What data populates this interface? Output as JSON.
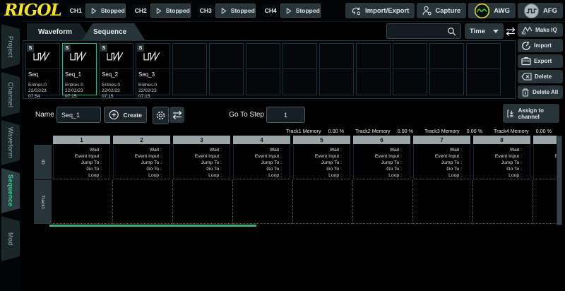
{
  "brand": "RIGOL",
  "colors": {
    "accent_green": "#3fd695",
    "brand_yellow": "#f6e41c",
    "header_gray": "#9aa3a6",
    "scrollbar_green": "#3fae7d"
  },
  "topbar": {
    "channels": [
      {
        "label": "CH1",
        "status": "Stopped"
      },
      {
        "label": "CH2",
        "status": "Stopped"
      },
      {
        "label": "CH3",
        "status": "Stopped"
      },
      {
        "label": "CH4",
        "status": "Stopped"
      }
    ],
    "import_export": "Import/Export",
    "capture": "Capture",
    "awg": "AWG",
    "afg": "AFG"
  },
  "sidebar": {
    "items": [
      {
        "label": "Project"
      },
      {
        "label": "Channel"
      },
      {
        "label": "Waveform"
      },
      {
        "label": "Sequence",
        "selected": true
      },
      {
        "label": "Mod"
      }
    ]
  },
  "browser": {
    "tabs": [
      {
        "label": "Waveform"
      },
      {
        "label": "Sequence",
        "selected": true
      }
    ],
    "search_placeholder": "",
    "sort_value": "Time",
    "badge": "S",
    "cards": [
      {
        "name": "Seq",
        "entries": "Entries:0",
        "date": "22/02/23 07:54",
        "selected": false
      },
      {
        "name": "Seq_1",
        "entries": "Entries:0",
        "date": "22/02/23 07:15",
        "selected": true
      },
      {
        "name": "Seq_2",
        "entries": "Entries:0",
        "date": "22/02/23 07:15",
        "selected": false
      },
      {
        "name": "Seq_3",
        "entries": "Entries:0",
        "date": "22/02/23 07:15",
        "selected": false
      }
    ],
    "empty_slots": 9
  },
  "actions": {
    "make_iq": "Make IQ",
    "import": "Import",
    "export": "Export",
    "delete": "Delete",
    "delete_all": "Delete All"
  },
  "editor": {
    "name_label": "Name",
    "name_value": "Seq_1",
    "create": "Create",
    "goto_label": "Go To Step",
    "goto_value": "1",
    "assign": "Assign to channel",
    "tracks": [
      {
        "label": "Track1  Memory",
        "value": "0.00 %"
      },
      {
        "label": "Track2  Memory",
        "value": "0.00 %"
      },
      {
        "label": "Track3  Memory",
        "value": "0.00 %"
      },
      {
        "label": "Track4  Memory",
        "value": "0.00 %"
      }
    ],
    "table": {
      "columns": [
        "1",
        "2",
        "3",
        "4",
        "5",
        "6",
        "7",
        "8",
        ""
      ],
      "row_headers": [
        "ID",
        "Track1"
      ],
      "cell_lines": [
        "Wait :",
        "Event Input :",
        "Jump To :",
        "Go To :",
        "Loop :"
      ]
    }
  }
}
